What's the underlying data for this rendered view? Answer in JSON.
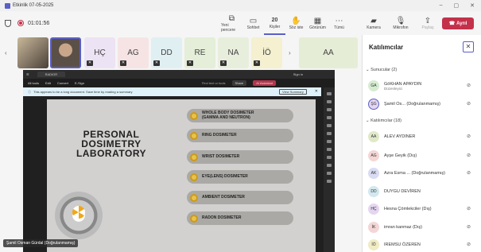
{
  "window": {
    "title": "Etkinlik 07-05-2025"
  },
  "toolbar": {
    "timer": "01:01:56",
    "buttons": [
      {
        "label": "Yeni pencere",
        "icon": "new-window-icon",
        "glyph": "⧉"
      },
      {
        "label": "Sohbet",
        "icon": "chat-icon",
        "glyph": "💬"
      },
      {
        "label": "Kişiler",
        "icon": "people-icon",
        "glyph": "20"
      },
      {
        "label": "Söz iste",
        "icon": "raise-hand-icon",
        "glyph": "✋"
      },
      {
        "label": "Görünüm",
        "icon": "view-icon",
        "glyph": "▦"
      },
      {
        "label": "Tümü",
        "icon": "more-icon",
        "glyph": "⋯"
      }
    ],
    "camera_label": "Kamera",
    "mic_label": "Mikrofon",
    "share_label": "Paylaş",
    "leave_label": "Ayrıl"
  },
  "strip": {
    "tiles": [
      "HÇ",
      "AG",
      "DD",
      "RE",
      "NA",
      "İÖ",
      "AA"
    ],
    "overflow_label": "AA"
  },
  "stage": {
    "browser_tab": "RADIOR",
    "signin": "Sign in",
    "pdf_menu": [
      "All tools",
      "Edit",
      "Convert",
      "E-Sign"
    ],
    "find_placeholder": "Find text or tools",
    "share_label": "Share",
    "ai_label": "AI Assistant",
    "notice_text": "This appears to be a long document. Save time by reading a summary",
    "view_summary_label": "View Summary",
    "slide": {
      "title_lines": [
        "PERSONAL",
        "DOSIMETRY",
        "LABORATORY"
      ],
      "items": [
        "WHOLE BODY DOSIMETER (GAMMA AND NEUTRON)",
        "RING DOSIMETER",
        "WRIST DOSIMETER",
        "EYE(LENS) DOSIMETER",
        "AMBIENT DOSIMETER",
        "RADON  DOSIMETER"
      ]
    },
    "presenter_tag": "Şamil Osman Gürdal (Doğrulanmamış)"
  },
  "panel": {
    "title": "Katılımcılar",
    "organizers_header": "Sunucular (2)",
    "attendees_header": "Katılımcılar (18)",
    "organizers": [
      {
        "initials": "GA",
        "name": "GöKHAN APAYDIN",
        "sub": "Düzenleyici",
        "color": "#d6ecd2"
      },
      {
        "initials": "ŞG",
        "name": "Şamil Os... (Doğrulanmamış)",
        "sub": "",
        "color": "#e4d6f0"
      }
    ],
    "attendees": [
      {
        "initials": "AA",
        "name": "ALEV AYDINER",
        "color": "#dfe9c8"
      },
      {
        "initials": "AG",
        "name": "Ayşe Geyik (Dış)",
        "color": "#f4d6d6"
      },
      {
        "initials": "AK",
        "name": "Azra Esma ... (Doğrulanmamış)",
        "color": "#d9dcf2"
      },
      {
        "initials": "DD",
        "name": "DUYGU DEVİREN",
        "color": "#d2e8ee"
      },
      {
        "initials": "HÇ",
        "name": "Hesna Çömlekciler (Dış)",
        "color": "#e4d6f0"
      },
      {
        "initials": "İK",
        "name": "imran kanmaz (Dış)",
        "color": "#f4d6d6"
      },
      {
        "initials": "İÖ",
        "name": "IREMSU ÖZEREN",
        "color": "#f0ecc4"
      }
    ]
  }
}
